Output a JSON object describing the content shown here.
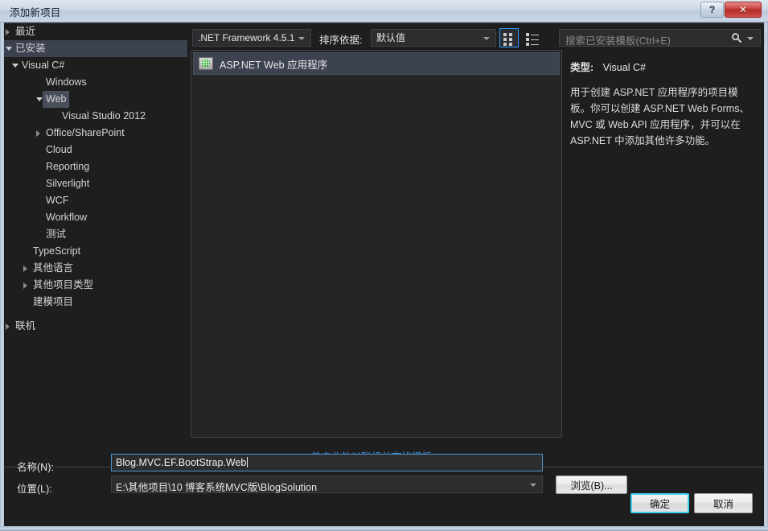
{
  "window": {
    "title": "添加新项目",
    "help_label": "?",
    "close_label": "✕"
  },
  "nav": {
    "items": [
      {
        "label": "最近",
        "indent": 14,
        "arrow": "right",
        "highlight": false,
        "selected": false
      },
      {
        "label": "已安装",
        "indent": 14,
        "arrow": "down",
        "highlight": true,
        "selected": false
      },
      {
        "label": "Visual C#",
        "indent": 22,
        "arrow": "down",
        "highlight": false,
        "selected": false
      },
      {
        "label": "Windows",
        "indent": 52,
        "arrow": "none",
        "highlight": false,
        "selected": false
      },
      {
        "label": "Web",
        "indent": 52,
        "arrow": "down-sub",
        "highlight": false,
        "selected": true
      },
      {
        "label": "Visual Studio 2012",
        "indent": 72,
        "arrow": "none",
        "highlight": false,
        "selected": false
      },
      {
        "label": "Office/SharePoint",
        "indent": 52,
        "arrow": "right-sub",
        "highlight": false,
        "selected": false
      },
      {
        "label": "Cloud",
        "indent": 52,
        "arrow": "none",
        "highlight": false,
        "selected": false
      },
      {
        "label": "Reporting",
        "indent": 52,
        "arrow": "none",
        "highlight": false,
        "selected": false
      },
      {
        "label": "Silverlight",
        "indent": 52,
        "arrow": "none",
        "highlight": false,
        "selected": false
      },
      {
        "label": "WCF",
        "indent": 52,
        "arrow": "none",
        "highlight": false,
        "selected": false
      },
      {
        "label": "Workflow",
        "indent": 52,
        "arrow": "none",
        "highlight": false,
        "selected": false
      },
      {
        "label": "测试",
        "indent": 52,
        "arrow": "none",
        "highlight": false,
        "selected": false
      },
      {
        "label": "TypeScript",
        "indent": 36,
        "arrow": "none",
        "highlight": false,
        "selected": false
      },
      {
        "label": "其他语言",
        "indent": 36,
        "arrow": "right-sub2",
        "highlight": false,
        "selected": false
      },
      {
        "label": "其他项目类型",
        "indent": 36,
        "arrow": "right-sub2",
        "highlight": false,
        "selected": false
      },
      {
        "label": "建模项目",
        "indent": 36,
        "arrow": "none",
        "highlight": false,
        "selected": false
      },
      {
        "label": "联机",
        "indent": 14,
        "arrow": "right",
        "highlight": false,
        "selected": false,
        "spacer_before": true
      }
    ]
  },
  "toolbar": {
    "framework": ".NET Framework 4.5.1",
    "sort_label": "排序依据:",
    "sort_value": "默认值",
    "view_grid_name": "medium-icons-view",
    "view_list_name": "list-view"
  },
  "search": {
    "placeholder": "搜索已安装模板(Ctrl+E)"
  },
  "templates": {
    "items": [
      {
        "name": "ASP.NET Web 应用程序",
        "selected": true
      }
    ],
    "online_link": "单击此处以联机并查找模板。"
  },
  "info": {
    "type_label": "类型:",
    "type_value": "Visual C#",
    "description": "用于创建 ASP.NET 应用程序的项目模板。你可以创建 ASP.NET Web Forms、MVC 或 Web API 应用程序，并可以在 ASP.NET 中添加其他许多功能。"
  },
  "form": {
    "name_label": "名称(N):",
    "name_value": "Blog.MVC.EF.BootStrap.Web",
    "location_label": "位置(L):",
    "location_value": "E:\\其他项目\\10 博客系统MVC版\\BlogSolution",
    "browse_label": "浏览(B)...",
    "ok_label": "确定",
    "cancel_label": "取消"
  },
  "colors": {
    "dialog_bg": "#1e1e1e",
    "panel_bg": "#252526",
    "selection": "#3d4250",
    "accent_focus": "#4f94ce",
    "default_button_glow": "#3fd0ef",
    "link": "#3b8fe0",
    "close_button": "#c9403c"
  }
}
